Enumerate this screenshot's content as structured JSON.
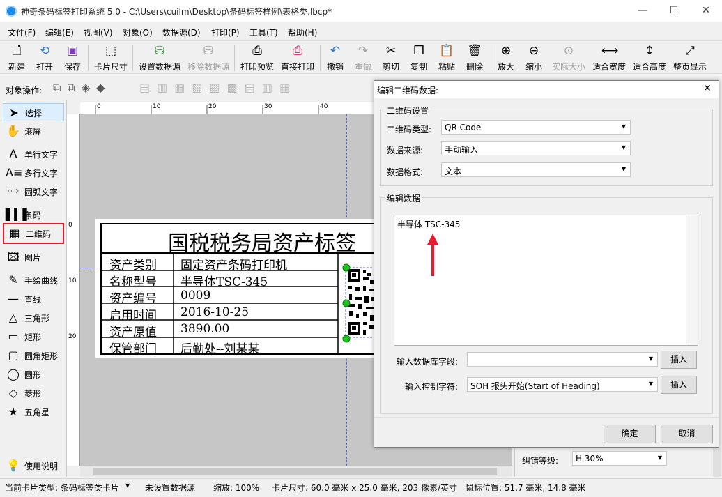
{
  "window": {
    "title": "神奇条码标签打印系统 5.0 - C:\\Users\\cuilm\\Desktop\\条码标签样例\\表格类.lbcp*"
  },
  "menu": [
    "文件(F)",
    "编辑(E)",
    "视图(V)",
    "对象(O)",
    "数据源(D)",
    "打印(P)",
    "工具(T)",
    "帮助(H)"
  ],
  "toolbar": {
    "new": "新建",
    "open": "打开",
    "save": "保存",
    "card_size": "卡片尺寸",
    "set_datasource": "设置数据源",
    "remove_datasource": "移除数据源",
    "print_preview": "打印预览",
    "direct_print": "直接打印",
    "undo": "撤销",
    "redo": "重做",
    "cut": "剪切",
    "copy": "复制",
    "paste": "粘贴",
    "delete": "删除",
    "zoom_in": "放大",
    "zoom_out": "缩小",
    "actual_size": "实际大小",
    "fit_width": "适合宽度",
    "fit_height": "适合高度",
    "fit_page": "整页显示"
  },
  "object_ops": {
    "label": "对象操作:"
  },
  "tools": [
    "选择",
    "滚屏",
    "单行文字",
    "多行文字",
    "圆弧文字",
    "条码",
    "二维码",
    "图片",
    "手绘曲线",
    "直线",
    "三角形",
    "矩形",
    "圆角矩形",
    "圆形",
    "菱形",
    "五角星",
    "使用说明"
  ],
  "ruler": {
    "marks": [
      "0",
      "10",
      "20",
      "30",
      "40"
    ]
  },
  "label": {
    "title": "国税税务局资产标签",
    "rows": [
      {
        "key": "资产类别",
        "value": "固定资产条码打印机"
      },
      {
        "key": "名称型号",
        "value": "半导体TSC-345"
      },
      {
        "key": "资产编号",
        "value": "0009"
      },
      {
        "key": "启用时间",
        "value": "2016-10-25"
      },
      {
        "key": "资产原值",
        "value": "3890.00"
      },
      {
        "key": "保管部门",
        "value": "后勤处--刘某某"
      }
    ]
  },
  "dialog": {
    "title": "编辑二维码数据:",
    "group1": "二维码设置",
    "type_label": "二维码类型:",
    "type_value": "QR Code",
    "source_label": "数据来源:",
    "source_value": "手动输入",
    "format_label": "数据格式:",
    "format_value": "文本",
    "group2": "编辑数据",
    "data_text": "半导体 TSC-345",
    "db_field_label": "输入数据库字段:",
    "db_field_value": "",
    "insert1": "插入",
    "ctrl_label": "输入控制字符:",
    "ctrl_value": "SOH  报头开始(Start of Heading)",
    "insert2": "插入",
    "ok": "确定",
    "cancel": "取消"
  },
  "props": {
    "ecc_label": "纠错等级:",
    "ecc_value": "H 30%"
  },
  "status": {
    "card_type": "当前卡片类型: 条码标签类卡片",
    "datasource": "未设置数据源",
    "zoom": "缩放: 100%",
    "card_size": "卡片尺寸: 60.0 毫米 x 25.0 毫米, 203 像素/英寸",
    "mouse": "鼠标位置: 51.7 毫米, 14.8 毫米"
  },
  "colors": {
    "accent_red": "#e8192c",
    "selection_green": "#1ec21e",
    "canvas_bg": "#c6c6c6"
  }
}
